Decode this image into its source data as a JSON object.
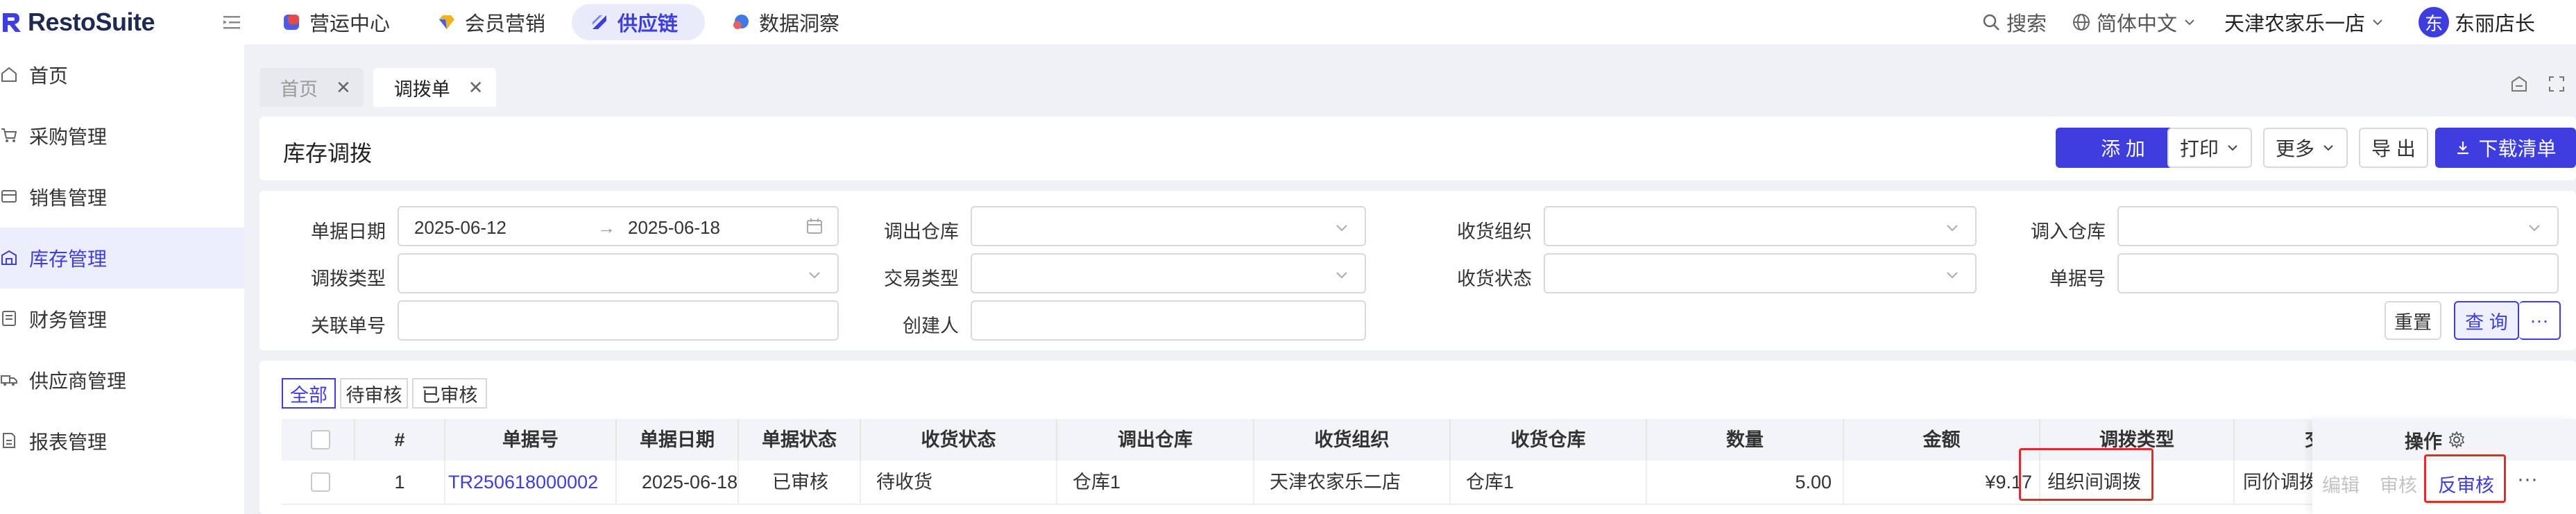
{
  "brand": {
    "name": "RestoSuite",
    "accent": "#3d3de0"
  },
  "topnav": {
    "items": [
      {
        "label": "营运中心",
        "icon": "operations-icon"
      },
      {
        "label": "会员营销",
        "icon": "member-icon"
      },
      {
        "label": "供应链",
        "icon": "supply-chain-icon",
        "active": true
      },
      {
        "label": "数据洞察",
        "icon": "data-icon"
      }
    ],
    "search": "搜索",
    "language": "简体中文",
    "store": "天津农家乐一店",
    "avatar_char": "东",
    "user": "东丽店长"
  },
  "sidebar": {
    "items": [
      {
        "label": "首页",
        "icon": "home-icon"
      },
      {
        "label": "采购管理",
        "icon": "cart-icon"
      },
      {
        "label": "销售管理",
        "icon": "sales-icon"
      },
      {
        "label": "库存管理",
        "icon": "warehouse-icon",
        "active": true
      },
      {
        "label": "财务管理",
        "icon": "finance-icon"
      },
      {
        "label": "供应商管理",
        "icon": "supplier-icon"
      },
      {
        "label": "报表管理",
        "icon": "report-icon"
      }
    ]
  },
  "tabs": [
    {
      "label": "首页",
      "active": false
    },
    {
      "label": "调拨单",
      "active": true
    }
  ],
  "header": {
    "title": "库存调拨",
    "add": "添 加",
    "print": "打印",
    "more": "更多",
    "export": "导 出",
    "download": "下载清单"
  },
  "filters": {
    "date_label": "单据日期",
    "date_start": "2025-06-12",
    "date_arrow": "→",
    "date_end": "2025-06-18",
    "out_wh_label": "调出仓库",
    "recv_org_label": "收货组织",
    "in_wh_label": "调入仓库",
    "type_label": "调拨类型",
    "trade_type_label": "交易类型",
    "recv_status_label": "收货状态",
    "doc_no_label": "单据号",
    "rel_no_label": "关联单号",
    "creator_label": "创建人",
    "reset": "重置",
    "query": "查 询",
    "more": "···"
  },
  "status_tabs": [
    "全部",
    "待审核",
    "已审核"
  ],
  "table": {
    "columns": [
      "#",
      "单据号",
      "单据日期",
      "单据状态",
      "收货状态",
      "调出仓库",
      "收货组织",
      "收货仓库",
      "数量",
      "金额",
      "调拨类型",
      "交",
      "操作"
    ],
    "rows": [
      {
        "index": "1",
        "doc_no": "TR250618000002",
        "date": "2025-06-18",
        "doc_status": "已审核",
        "recv_status": "待收货",
        "out_wh": "仓库1",
        "recv_org": "天津农家乐二店",
        "recv_wh": "仓库1",
        "qty": "5.00",
        "amount": "¥9.17",
        "type": "组织间调拨",
        "trade": "同价调拨",
        "op_edit": "编辑",
        "op_audit": "审核",
        "op_unaudit": "反审核",
        "op_more": "···"
      }
    ]
  }
}
